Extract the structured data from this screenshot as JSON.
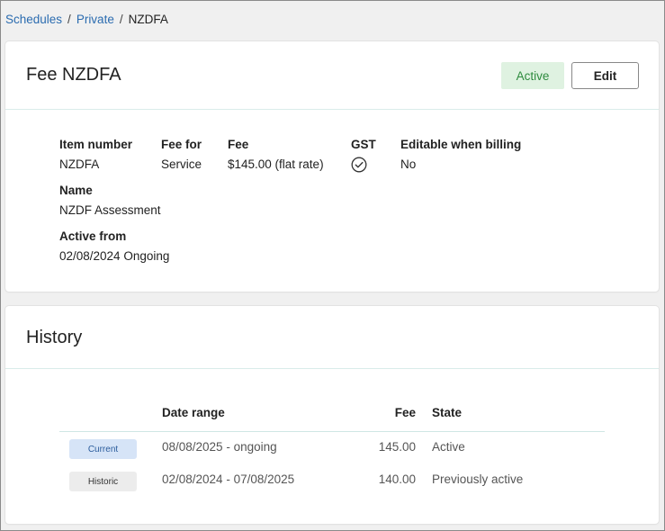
{
  "breadcrumb": {
    "items": [
      "Schedules",
      "Private"
    ],
    "separator": "/",
    "current": "NZDFA"
  },
  "fee_card": {
    "title": "Fee NZDFA",
    "status_badge": "Active",
    "edit_label": "Edit",
    "fields": {
      "item_number_label": "Item number",
      "item_number_value": "NZDFA",
      "fee_for_label": "Fee for",
      "fee_for_value": "Service",
      "fee_label": "Fee",
      "fee_value": "$145.00 (flat rate)",
      "gst_label": "GST",
      "gst_icon": "check-circle-icon",
      "editable_label": "Editable when billing",
      "editable_value": "No",
      "name_label": "Name",
      "name_value": "NZDF Assessment",
      "active_from_label": "Active from",
      "active_from_value": "02/08/2024 Ongoing"
    }
  },
  "history_card": {
    "title": "History",
    "columns": {
      "date_range": "Date range",
      "fee": "Fee",
      "state": "State"
    },
    "rows": [
      {
        "tag": "Current",
        "date_range": "08/08/2025 - ongoing",
        "fee": "145.00",
        "state": "Active"
      },
      {
        "tag": "Historic",
        "date_range": "02/08/2024 - 07/08/2025",
        "fee": "140.00",
        "state": "Previously active"
      }
    ]
  },
  "colors": {
    "link": "#2b6cb0",
    "active_badge_bg": "#dff2e1",
    "active_badge_text": "#2e8b3e",
    "current_pill_bg": "#d6e4f7",
    "historic_pill_bg": "#ececec"
  }
}
